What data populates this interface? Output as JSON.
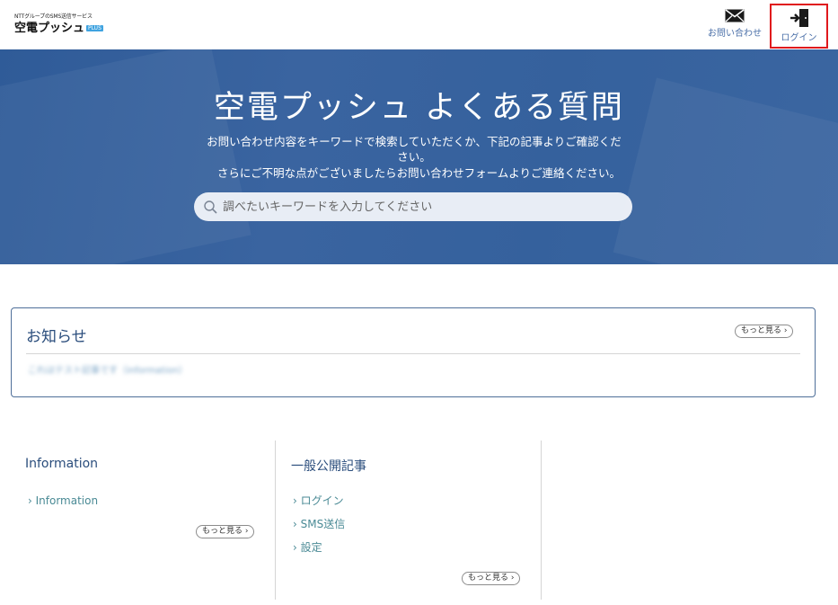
{
  "header": {
    "logo_tagline": "NTTグループのSMS送信サービス",
    "logo_title": "空電プッシュ",
    "logo_badge": "PLUS",
    "contact_label": "お問い合わせ",
    "login_label": "ログイン",
    "contact_icon": "envelope-icon",
    "login_icon": "door-enter-icon"
  },
  "hero": {
    "title": "空電プッシュ よくある質問",
    "description_line1": "お問い合わせ内容をキーワードで検索していただくか、下記の記事よりご確認ください。",
    "description_line2": "さらにご不明な点がございましたらお問い合わせフォームよりご連絡ください。",
    "search_placeholder": "調べたいキーワードを入力してください"
  },
  "notice": {
    "title": "お知らせ",
    "more_label": "もっと見る ›",
    "item": "これはテスト記事です（information）"
  },
  "categories": [
    {
      "title": "Information",
      "items": [
        "› Information"
      ],
      "more_label": "もっと見る ›"
    },
    {
      "title": "一般公開記事",
      "items": [
        "› ログイン",
        "› SMS送信",
        "› 設定"
      ],
      "more_label": "もっと見る ›"
    }
  ],
  "colors": {
    "hero_bg": "#35619d",
    "accent": "#2a4d7c",
    "link": "#4a8a95",
    "highlight_border": "#e0181c"
  }
}
